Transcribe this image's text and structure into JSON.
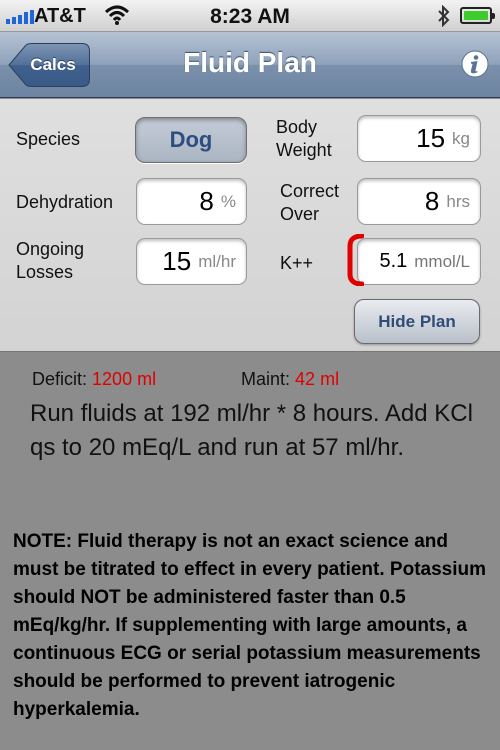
{
  "status_bar": {
    "carrier": "AT&T",
    "time": "8:23 AM",
    "icons": [
      "signal-bars-icon",
      "wifi-icon",
      "bluetooth-icon",
      "battery-icon"
    ]
  },
  "nav": {
    "back_label": "Calcs",
    "title": "Fluid Plan",
    "info_icon": "info-icon"
  },
  "form": {
    "species_label": "Species",
    "species_value": "Dog",
    "body_weight_label": "Body Weight",
    "body_weight_value": "15",
    "body_weight_unit": "kg",
    "dehydration_label": "Dehydration",
    "dehydration_value": "8",
    "dehydration_unit": "%",
    "correct_over_label": "Correct Over",
    "correct_over_value": "8",
    "correct_over_unit": "hrs",
    "ongoing_losses_label": "Ongoing Losses",
    "ongoing_losses_value": "15",
    "ongoing_losses_unit": "ml/hr",
    "potassium_label": "K++",
    "potassium_value": "5.1",
    "potassium_unit": "mmol/L",
    "hide_plan_label": "Hide Plan"
  },
  "results": {
    "deficit_label": "Deficit:",
    "deficit_value": "1200 ml",
    "maint_label": "Maint:",
    "maint_value": "42 ml",
    "plan_text": "Run fluids at 192 ml/hr * 8 hours. Add KCl qs to 20 mEq/L and run at 57 ml/hr.",
    "note_text": "NOTE: Fluid therapy is not an exact science and must be titrated to effect in every patient. Potassium should NOT be administered faster than 0.5 mEq/kg/hr. If supplementing with large amounts, a continuous ECG or serial potassium measurements should be performed to prevent iatrogenic hyperkalemia."
  },
  "colors": {
    "nav_bar": "#7a90ab",
    "form_background": "#d8d8d8",
    "results_background": "#8c8c8c",
    "highlight_red": "#e00000",
    "button_text": "#2e4d80",
    "battery_green": "#3dcc2c"
  }
}
